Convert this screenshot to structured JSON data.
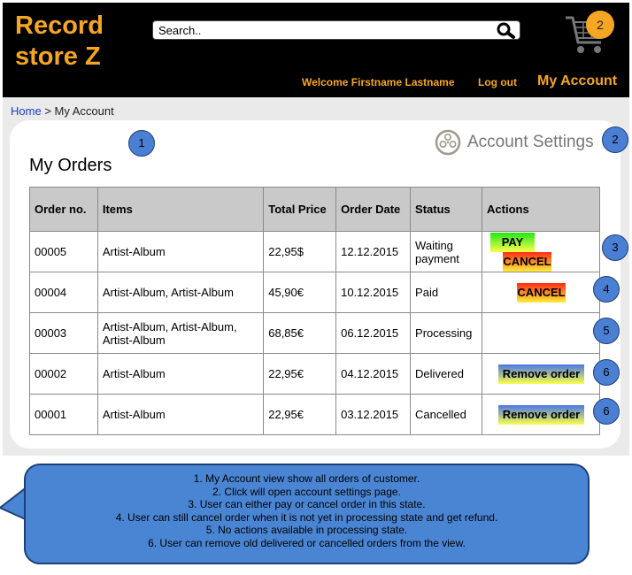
{
  "header": {
    "logo_line1": "Record",
    "logo_line2": "store Z",
    "search_placeholder": "Search..",
    "cart_count": "2",
    "welcome": "Welcome Firstname Lastname",
    "logout": "Log out",
    "my_account": "My Account"
  },
  "breadcrumb": {
    "home": "Home",
    "separator": ">",
    "current": "My Account"
  },
  "page_title": "My Orders",
  "settings_label": "Account Settings",
  "table": {
    "headers": [
      "Order no.",
      "Items",
      "Total Price",
      "Order Date",
      "Status",
      "Actions"
    ],
    "rows": [
      {
        "no": "00005",
        "items": "Artist-Album",
        "price": "22,95$",
        "date": "12.12.2015",
        "status": "Waiting payment",
        "pay": "PAY",
        "cancel": "CANCEL"
      },
      {
        "no": "00004",
        "items": "Artist-Album, Artist-Album",
        "price": "45,90€",
        "date": "10.12.2015",
        "status": "Paid",
        "cancel": "CANCEL"
      },
      {
        "no": "00003",
        "items": "Artist-Album, Artist-Album, Artist-Album",
        "price": "68,85€",
        "date": "06.12.2015",
        "status": "Processing"
      },
      {
        "no": "00002",
        "items": "Artist-Album",
        "price": "22,95€",
        "date": "04.12.2015",
        "status": "Delivered",
        "remove": "Remove order"
      },
      {
        "no": "00001",
        "items": "Artist-Album",
        "price": "22,95€",
        "date": "03.12.2015",
        "status": "Cancelled",
        "remove": "Remove order"
      }
    ]
  },
  "markers": [
    "1",
    "2",
    "3",
    "4",
    "5",
    "6",
    "6"
  ],
  "notes": [
    "1. My Account view show all orders of customer.",
    "2. Click will open account settings page.",
    "3. User can either pay or cancel order in this state.",
    "4. User can still cancel order when it is not yet in processing state and get refund.",
    "5. No actions available in processing state.",
    "6. User can remove old delivered or cancelled orders from the view."
  ],
  "colors": {
    "brand": "#f5a623",
    "header_bg": "#000000",
    "marker": "#4a7fd4",
    "link": "#1a3fc4"
  },
  "icons": {
    "search": "magnifier-icon",
    "cart": "shopping-cart-icon",
    "settings": "film-reel-icon"
  }
}
